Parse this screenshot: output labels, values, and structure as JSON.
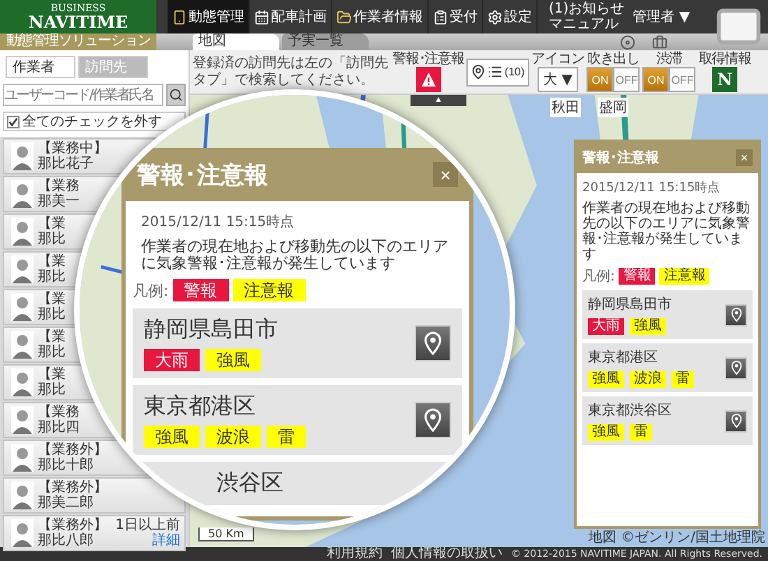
{
  "header": {
    "logo": {
      "line_1": "BUSINESS",
      "line_2": "NAVITIME",
      "tagline": "動態管理ソリューション"
    },
    "nav": [
      {
        "label": "動態管理",
        "kind": "tracking",
        "selected": true
      },
      {
        "label": "配車計画",
        "kind": "dispatch",
        "selected": false
      },
      {
        "label": "作業者情報",
        "kind": "workers",
        "selected": false
      },
      {
        "label": "受付",
        "kind": "reception",
        "selected": false
      },
      {
        "label": "設定",
        "kind": "settings",
        "selected": false
      }
    ],
    "notice": "(1)お知らせ",
    "manual": "マニュアル",
    "user": "管理者",
    "user_caret": "▼"
  },
  "view_tabs": [
    {
      "label": "地図",
      "selected": true
    },
    {
      "label": "予実一覧",
      "selected": false
    }
  ],
  "sidebar": {
    "tabs": [
      {
        "label": "作業者",
        "selected": true
      },
      {
        "label": "訪問先",
        "selected": false
      }
    ],
    "search": {
      "placeholder": "ユーザーコード/作業者氏名"
    },
    "uncheck_all": {
      "label": "全てのチェックを外す",
      "checked": true
    },
    "workers": [
      {
        "status": "【業務中】",
        "name": "那比花子"
      },
      {
        "status": "【業務",
        "name": "那美一"
      },
      {
        "status": "【業",
        "name": "那比"
      },
      {
        "status": "【業",
        "name": "那比"
      },
      {
        "status": "【業",
        "name": "那比"
      },
      {
        "status": "【業",
        "name": "那比"
      },
      {
        "status": "【業",
        "name": "那比"
      },
      {
        "status": "【業務",
        "name": "那比四"
      },
      {
        "status": "【業務外】",
        "name": "那比十郎"
      },
      {
        "status": "【業務外】",
        "name": "那美二郎"
      },
      {
        "status": "【業務外】",
        "name": "那比八郎",
        "last_seen": "1日以上前",
        "detail": "詳細"
      }
    ]
  },
  "toolbar": {
    "hint": "登録済の訪問先は左の「訪問先タブ」で検索してください。",
    "alerts_label": "警報･注意報",
    "pin_count": "(10)",
    "icon_size": {
      "label": "アイコン",
      "value": "大",
      "caret": "▼"
    },
    "balloon": {
      "label": "吹き出し",
      "on": true,
      "on_text": "ON",
      "off_text": "OFF"
    },
    "traffic": {
      "label": "渋滞",
      "on": true,
      "on_text": "ON",
      "off_text": "OFF"
    },
    "info": {
      "label": "取得情報",
      "button": "N"
    },
    "collapse": "▲"
  },
  "map": {
    "labels": [
      "秋田",
      "盛岡"
    ],
    "scale": "50 Km",
    "credit": "地図 ©ゼンリン/国土地理院"
  },
  "alert_panel": {
    "title": "警報･注意報",
    "close": "×",
    "date": "2015/12/11 15:15時点",
    "message": "作業者の現在地および移動先の以下のエリアに気象警報･注意報が発生しています",
    "legend_label": "凡例:",
    "legend": [
      {
        "label": "警報",
        "color": "#e8173f"
      },
      {
        "label": "注意報",
        "color": "#ffff00"
      }
    ],
    "areas": [
      {
        "name": "静岡県島田市",
        "kind": "full",
        "tags": [
          {
            "label": "大雨",
            "color": "#e8173f"
          },
          {
            "label": "強風",
            "color": "#ffff00"
          }
        ]
      },
      {
        "name": "東京都港区",
        "kind": "full",
        "tags": [
          {
            "label": "強風",
            "color": "#ffff00"
          },
          {
            "label": "波浪",
            "color": "#ffff00"
          },
          {
            "label": "雷",
            "color": "#ffff00"
          }
        ]
      },
      {
        "name": "東京都渋谷区",
        "kind": "full",
        "tags": [
          {
            "label": "強風",
            "color": "#ffff00"
          },
          {
            "label": "雷",
            "color": "#ffff00"
          }
        ]
      }
    ]
  },
  "magnifier": {
    "title": "警報･注意報",
    "close": "×",
    "date": "2015/12/11 15:15時点",
    "message": "作業者の現在地および移動先の以下のエリアに気象警報･注意報が発生しています",
    "legend_label": "凡例:",
    "legend": [
      {
        "label": "警報",
        "color": "#e8173f"
      },
      {
        "label": "注意報",
        "color": "#ffff00"
      }
    ],
    "areas": [
      {
        "name": "静岡県島田市",
        "kind": "full",
        "tags": [
          {
            "label": "大雨",
            "color": "#e8173f"
          },
          {
            "label": "強風",
            "color": "#ffff00"
          }
        ]
      },
      {
        "name": "東京都港区",
        "kind": "full",
        "tags": [
          {
            "label": "強風",
            "color": "#ffff00"
          },
          {
            "label": "波浪",
            "color": "#ffff00"
          },
          {
            "label": "雷",
            "color": "#ffff00"
          }
        ]
      },
      {
        "name": "渋谷区",
        "kind": "cut"
      }
    ]
  },
  "footer": {
    "links": [
      "利用規約",
      "個人情報の取扱い"
    ],
    "copyright": "© 2012-2015 NAVITIME JAPAN. All Rights Reserved."
  }
}
